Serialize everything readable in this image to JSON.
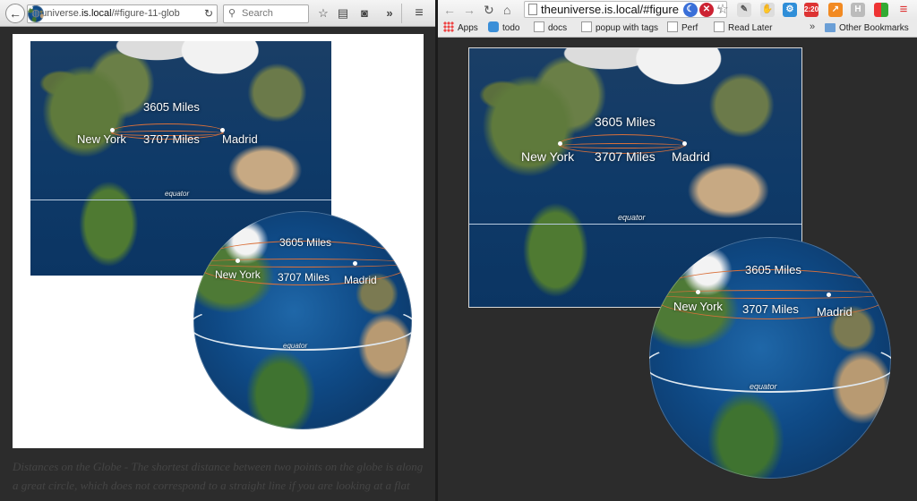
{
  "firefox": {
    "url_prefix": "theuniverse.",
    "url_host": "is.local",
    "url_rest": "/#figure-11-glob",
    "search_placeholder": "Search",
    "caption": "Distances on the Globe - The shortest distance between two points on the globe is along a great circle, which does not correspond to a straight line if you are looking at a flat map."
  },
  "chrome": {
    "url": "theuniverse.is.local/#figure",
    "ext_badge": "2:20",
    "bookmarks": [
      {
        "label": "Apps"
      },
      {
        "label": "todo"
      },
      {
        "label": "docs"
      },
      {
        "label": "popup with tags"
      },
      {
        "label": "Perf"
      },
      {
        "label": "Read Later"
      }
    ],
    "other_bookmarks": "Other Bookmarks",
    "more": "»"
  },
  "figure": {
    "label_top": "3605 Miles",
    "label_bottom": "3707 Miles",
    "city_west": "New York",
    "city_east": "Madrid",
    "equator": "equator"
  },
  "icons": {
    "back": "←",
    "forward": "→",
    "reload": "↻",
    "home": "⌂",
    "star": "☆",
    "menu": "≡"
  }
}
